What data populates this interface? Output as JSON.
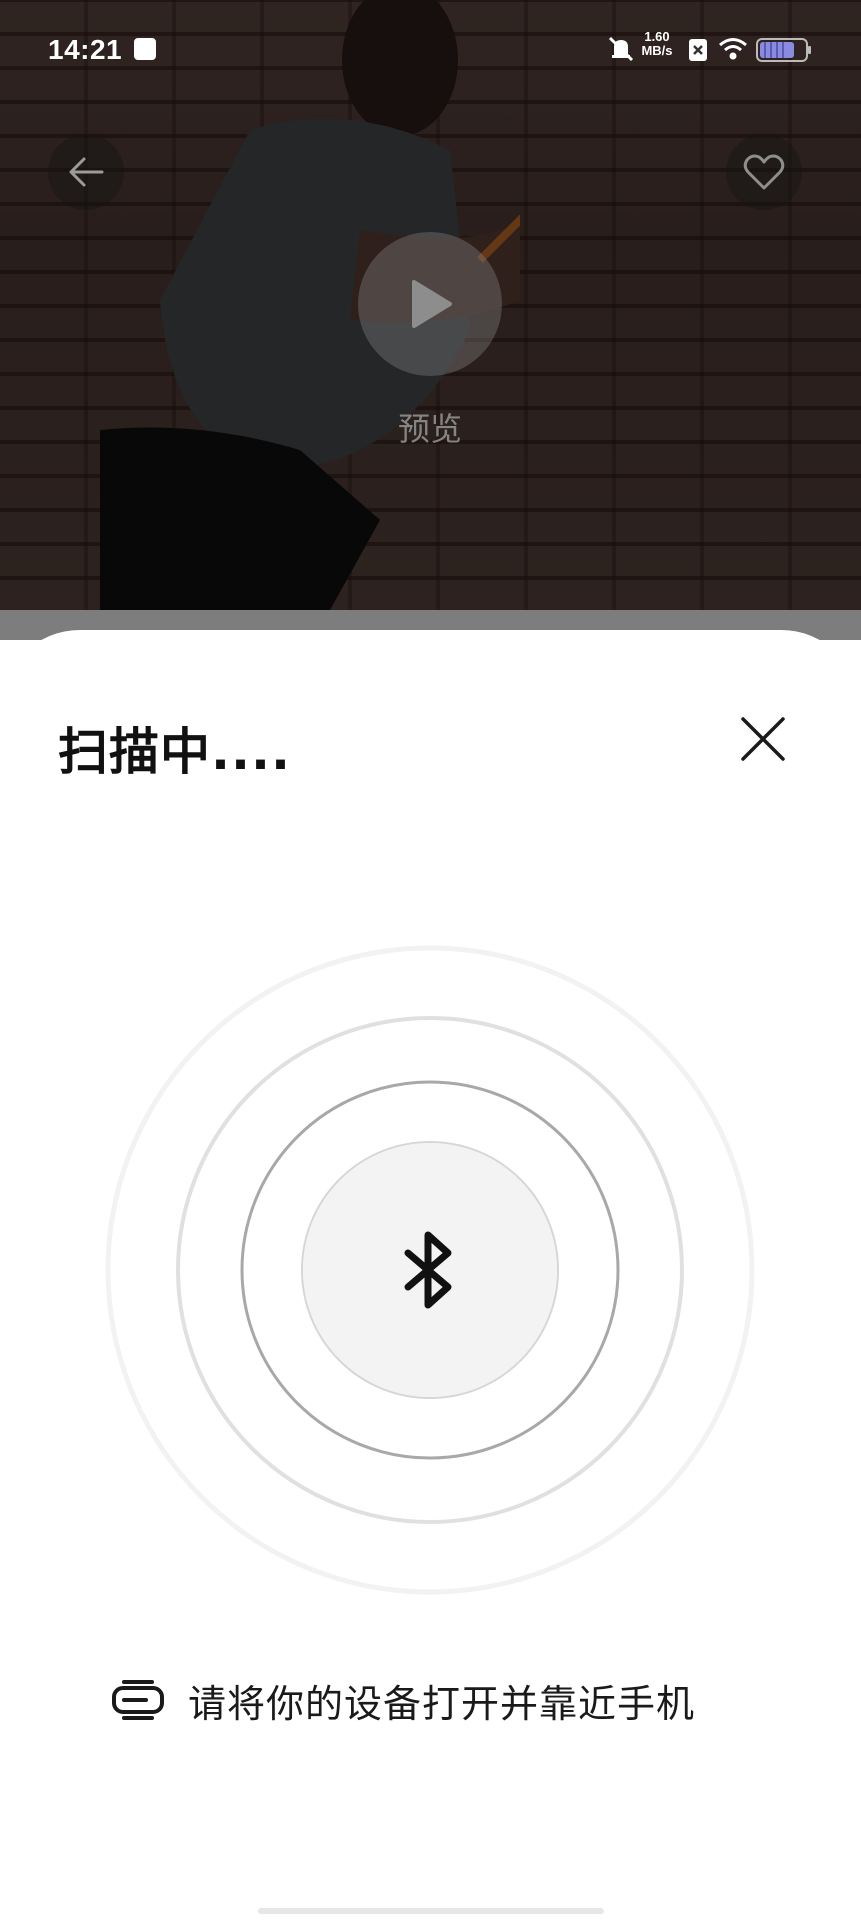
{
  "status_bar": {
    "time": "14:21",
    "net_speed_value": "1.60",
    "net_speed_unit": "MB/s",
    "icons": [
      "calendar-icon",
      "mute-bell-icon",
      "sim-x-icon",
      "wifi-icon",
      "battery-icon"
    ]
  },
  "video": {
    "preview_label": "预览",
    "icons": [
      "back-arrow-icon",
      "heart-icon",
      "play-icon"
    ]
  },
  "sheet": {
    "title": "扫描中....",
    "close_icon": "close-icon",
    "center_icon": "bluetooth-icon",
    "hint_icon": "device-icon",
    "hint": "请将你的设备打开并靠近手机"
  },
  "colors": {
    "sheet_bg": "#ffffff",
    "title": "#111111",
    "ring": "#9a9a9a",
    "center_fill": "#f3f3f3"
  }
}
